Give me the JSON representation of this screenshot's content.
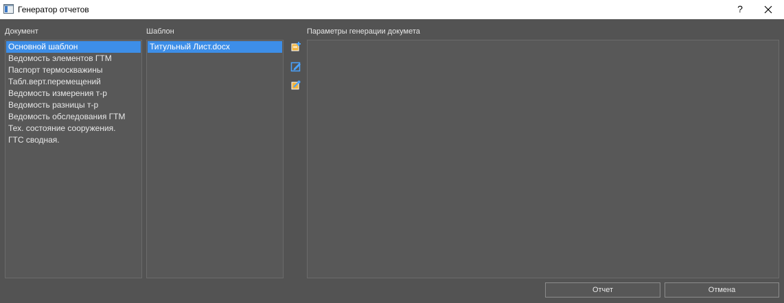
{
  "window": {
    "title": "Генератор отчетов",
    "help_label": "?",
    "close_icon": "close-icon"
  },
  "document_panel": {
    "label": "Документ",
    "items": [
      "Основной шаблон",
      "Ведомость элементов ГТМ",
      "Паспорт термоскважины",
      "Табл.верт.перемещений",
      "Ведомость измерения т-р",
      "Ведомость разницы т-р",
      "Ведомость обследования ГТМ",
      "Тех. состояние сооружения.",
      "ГТС сводная."
    ],
    "selected_index": 0
  },
  "template_panel": {
    "label": "Шаблон",
    "items": [
      "Титульный Лист.docx"
    ],
    "selected_index": 0,
    "tools": [
      "add-template-icon",
      "edit-template-icon",
      "template-settings-icon"
    ]
  },
  "params_panel": {
    "label": "Параметры  генерации  докумета"
  },
  "buttons": {
    "report": "Отчет",
    "cancel": "Отмена"
  },
  "colors": {
    "background": "#535353",
    "selection": "#3d8ee8",
    "titlebar": "#ffffff"
  }
}
